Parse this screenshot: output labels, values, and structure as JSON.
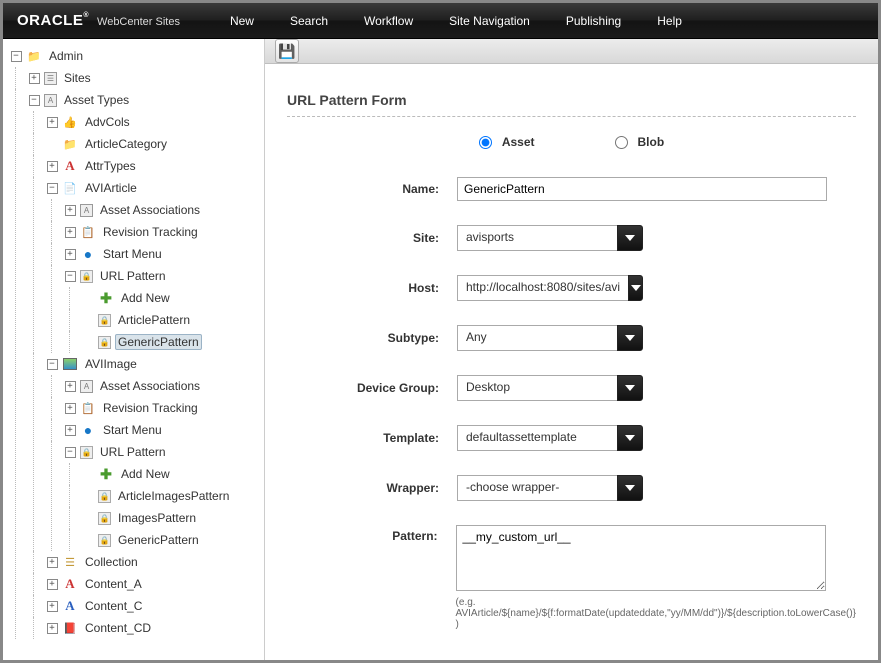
{
  "brand": {
    "oracle": "ORACLE",
    "product": "WebCenter Sites"
  },
  "menu": {
    "new": "New",
    "search": "Search",
    "workflow": "Workflow",
    "sitenav": "Site Navigation",
    "publishing": "Publishing",
    "help": "Help"
  },
  "tree": {
    "admin": "Admin",
    "sites": "Sites",
    "asset_types": "Asset Types",
    "advcols": "AdvCols",
    "articlecategory": "ArticleCategory",
    "attrtypes": "AttrTypes",
    "aviarticle": "AVIArticle",
    "asset_assoc": "Asset Associations",
    "rev_track": "Revision Tracking",
    "start_menu": "Start Menu",
    "url_pattern": "URL Pattern",
    "add_new": "Add New",
    "articlepattern": "ArticlePattern",
    "genericpattern": "GenericPattern",
    "aviimage": "AVIImage",
    "articleimagespattern": "ArticleImagesPattern",
    "imagespattern": "ImagesPattern",
    "collection": "Collection",
    "content_a": "Content_A",
    "content_c": "Content_C",
    "content_cd": "Content_CD"
  },
  "form": {
    "title": "URL Pattern Form",
    "radio_asset": "Asset",
    "radio_blob": "Blob",
    "labels": {
      "name": "Name:",
      "site": "Site:",
      "host": "Host:",
      "subtype": "Subtype:",
      "device_group": "Device Group:",
      "template": "Template:",
      "wrapper": "Wrapper:",
      "pattern": "Pattern:"
    },
    "values": {
      "name": "GenericPattern",
      "site": "avisports",
      "host": "http://localhost:8080/sites/avi",
      "subtype": "Any",
      "device_group": "Desktop",
      "template": "defaultassettemplate",
      "wrapper": "-choose wrapper-",
      "pattern": "__my_custom_url__"
    },
    "hint": "(e.g. AVIArticle/${name}/${f:formatDate(updateddate,\"yy/MM/dd\")}/${description.toLowerCase()} )"
  }
}
